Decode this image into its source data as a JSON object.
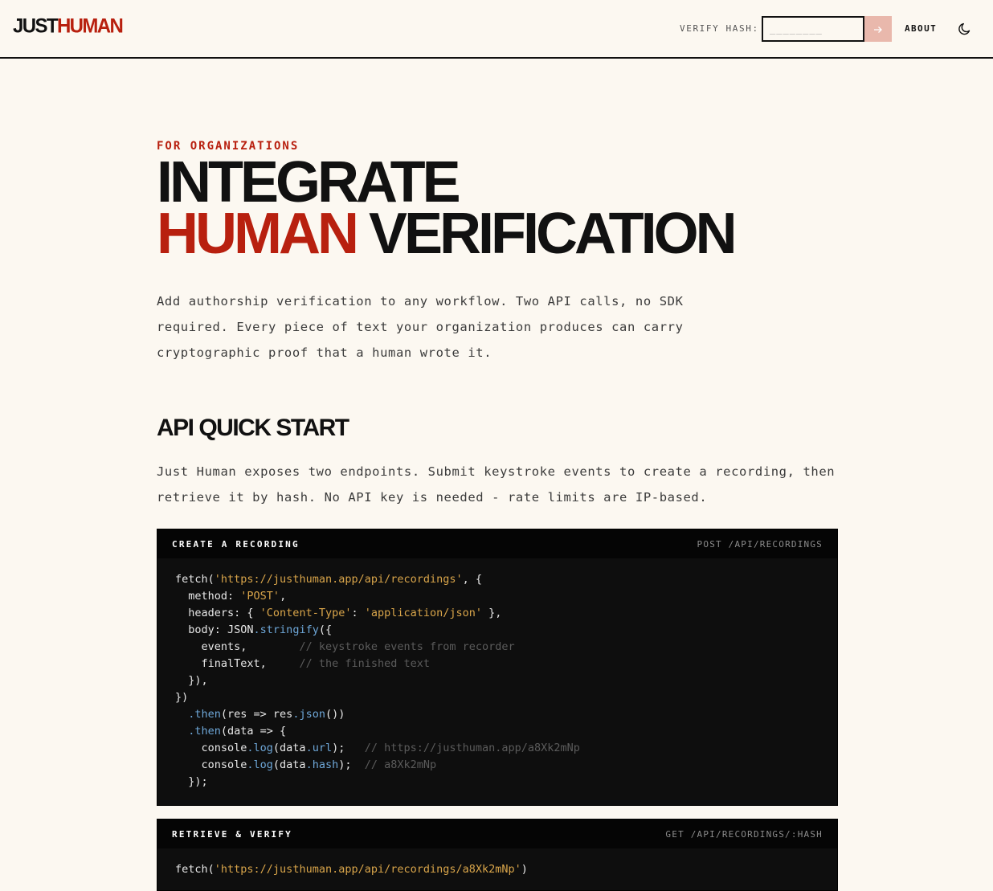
{
  "header": {
    "logo_part1": "JUST",
    "logo_part2": "HUMAN",
    "verify_label": "VERIFY HASH:",
    "verify_placeholder": "________",
    "submit_icon": "arrow-right-icon",
    "about_label": "ABOUT",
    "theme_icon": "moon-icon"
  },
  "hero": {
    "eyebrow": "FOR ORGANIZATIONS",
    "title_line1": "INTEGRATE",
    "title_red": "HUMAN",
    "title_rest": "VERIFICATION",
    "lead": "Add authorship verification to any workflow. Two API calls, no SDK required. Every piece of text your organization produces can carry cryptographic proof that a human wrote it."
  },
  "quickstart": {
    "title": "API QUICK START",
    "text": "Just Human exposes two endpoints. Submit keystroke events to create a recording, then retrieve it by hash. No API key is needed - rate limits are IP-based."
  },
  "create_block": {
    "title": "CREATE A RECORDING",
    "endpoint": "POST /API/RECORDINGS",
    "lines": [
      [
        [
          "fetch(",
          ""
        ],
        [
          "'https://justhuman.app/api/recordings'",
          "s"
        ],
        [
          ", {",
          ""
        ]
      ],
      [
        [
          "  method: ",
          ""
        ],
        [
          "'POST'",
          "s"
        ],
        [
          ",",
          ""
        ]
      ],
      [
        [
          "  headers: { ",
          ""
        ],
        [
          "'Content-Type'",
          "s"
        ],
        [
          ": ",
          ""
        ],
        [
          "'application/json'",
          "s"
        ],
        [
          " },",
          ""
        ]
      ],
      [
        [
          "  body: JSON",
          ""
        ],
        [
          ".stringify",
          "f"
        ],
        [
          "({",
          ""
        ]
      ],
      [
        [
          "    events,        ",
          ""
        ],
        [
          "// keystroke events from recorder",
          "c"
        ]
      ],
      [
        [
          "    finalText,     ",
          ""
        ],
        [
          "// the finished text",
          "c"
        ]
      ],
      [
        [
          "  }),",
          ""
        ]
      ],
      [
        [
          "})",
          ""
        ]
      ],
      [
        [
          "  ",
          ""
        ],
        [
          ".then",
          "f"
        ],
        [
          "(res => res",
          ""
        ],
        [
          ".json",
          "f"
        ],
        [
          "())",
          ""
        ]
      ],
      [
        [
          "  ",
          ""
        ],
        [
          ".then",
          "f"
        ],
        [
          "(data => {",
          ""
        ]
      ],
      [
        [
          "    console",
          ""
        ],
        [
          ".log",
          "f"
        ],
        [
          "(data",
          ""
        ],
        [
          ".url",
          "f"
        ],
        [
          ");   ",
          ""
        ],
        [
          "// https://justhuman.app/a8Xk2mNp",
          "c"
        ]
      ],
      [
        [
          "    console",
          ""
        ],
        [
          ".log",
          "f"
        ],
        [
          "(data",
          ""
        ],
        [
          ".hash",
          "f"
        ],
        [
          ");  ",
          ""
        ],
        [
          "// a8Xk2mNp",
          "c"
        ]
      ],
      [
        [
          "  });",
          ""
        ]
      ]
    ]
  },
  "retrieve_block": {
    "title": "RETRIEVE & VERIFY",
    "endpoint": "GET /API/RECORDINGS/:HASH",
    "lines": [
      [
        [
          "fetch(",
          ""
        ],
        [
          "'https://justhuman.app/api/recordings/a8Xk2mNp'",
          "s"
        ],
        [
          ")",
          ""
        ]
      ]
    ]
  },
  "colors": {
    "accent_red": "#b8200f",
    "background": "#fcf8f1",
    "code_bg": "#0e0e0e",
    "code_string": "#d9a54a",
    "code_function": "#6ea7d8",
    "code_comment": "#5b5b5b",
    "button_pink": "#e9b8ac"
  }
}
